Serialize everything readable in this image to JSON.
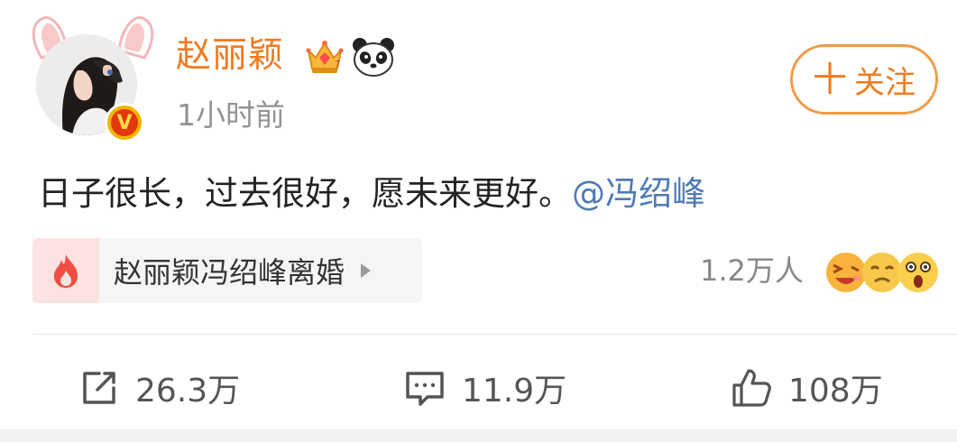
{
  "post": {
    "user_name": "赵丽颖",
    "time": "1小时前",
    "follow_label": "关注",
    "text": "日子很长，过去很好，愿未来更好。",
    "mention": "@冯绍峰"
  },
  "topic": {
    "label": "赵丽颖冯绍峰离婚",
    "reaction_count": "1.2万人"
  },
  "actions": {
    "repost_count": "26.3万",
    "comment_count": "11.9万",
    "like_count": "108万"
  },
  "icons": {
    "avatar": "avatar-image",
    "badge": "verified-v-badge",
    "crown": "crown-icon",
    "panda": "panda-icon",
    "fire": "fire-icon",
    "repost": "repost-icon",
    "comment": "comment-icon",
    "like": "thumbs-up-icon"
  },
  "colors": {
    "accent": "#f07b1f",
    "mention": "#4f7bb5",
    "fire": "#f04e43"
  }
}
